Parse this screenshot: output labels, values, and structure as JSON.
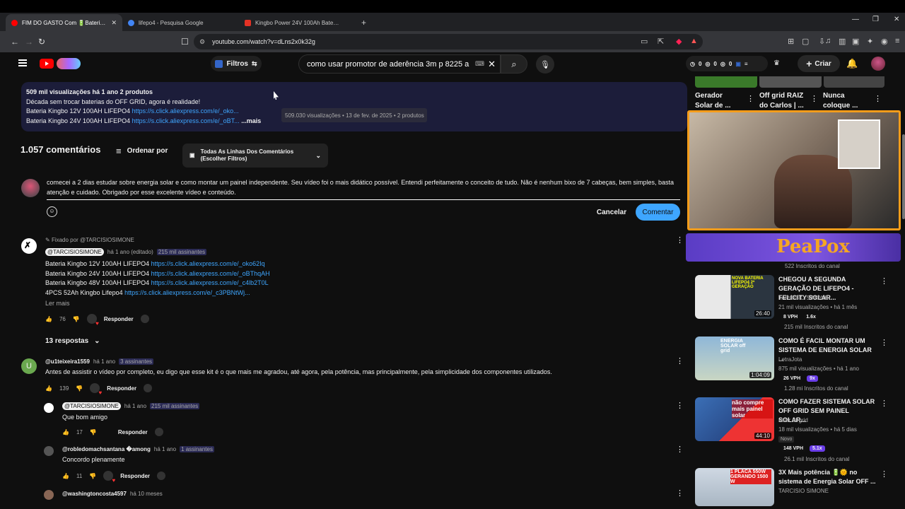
{
  "browser": {
    "tabs": [
      {
        "label": "FIM DO GASTO Com 🔋Baterias d",
        "active": true,
        "color": "#ff0000"
      },
      {
        "label": "lifepo4 - Pesquisa Google",
        "active": false,
        "color": "#4285f4"
      },
      {
        "label": "Kingbo Power 24V 100Ah Bateria Li",
        "active": false,
        "color": "#e43225"
      }
    ],
    "new_tab": "+",
    "url": "youtube.com/watch?v=dLns2x0k32g"
  },
  "youtube": {
    "filtros_label": "Filtros",
    "search_query": "como usar promotor de aderência 3m p 8225 a",
    "counters": [
      "0",
      "0",
      "0"
    ],
    "criar_label": "Criar"
  },
  "description": {
    "stats": "509 mil visualizações  há 1 ano  2 produtos",
    "line1": "Década sem trocar baterias do OFF GRID, agora é realidade!",
    "line2_text": "Bateria Kingbo 12V 100AH LIFEPO4",
    "line2_link": "https://s.click.aliexpress.com/e/_oko...",
    "line3_text": "Bateria Kingbo 24V 100AH LIFEPO4",
    "line3_link": "https://s.click.aliexpress.com/e/_oBT...",
    "more": "...mais",
    "tooltip": "509.030 visualizações • 13 de fev. de 2025 • 2 produtos"
  },
  "comments_header": {
    "count": "1.057 comentários",
    "sort_label": "Ordenar por",
    "filter_label_1": "Todas As Linhas Dos Comentários",
    "filter_label_2": "(Escolher Filtros)"
  },
  "new_comment": {
    "text": "comecei a 2 dias estudar sobre energia solar e como montar um painel independente. Seu vídeo foi o mais didático possível. Entendi perfeitamente o conceito de tudo. Não é nenhum bixo de 7 cabeças, bem simples, basta atenção e cuidado. Obrigado por esse excelente vídeo e conteúdo.",
    "cancel": "Cancelar",
    "submit": "Comentar"
  },
  "comments": [
    {
      "pinned": "Fixado por @TARCISIOSIMONE",
      "author": "@TARCISIOSIMONE",
      "time": "há 1 ano (editado)",
      "subs": "215 mil assinantes",
      "lines": [
        {
          "text": "Bateria Kingbo 12V 100AH LIFEPO4 ",
          "link": "https://s.click.aliexpress.com/e/_oko62Iq"
        },
        {
          "text": "Bateria Kingbo 24V 100AH LIFEPO4 ",
          "link": "https://s.click.aliexpress.com/e/_oBThqAH"
        },
        {
          "text": "Bateria Kingbo 48V 100AH LIFEPO4 ",
          "link": "https://s.click.aliexpress.com/e/_c4lb2T0L"
        },
        {
          "text": "4PCS 52Ah  Kingbo Lifepo4 ",
          "link": "https://s.click.aliexpress.com/e/_c3PBNtWj..."
        }
      ],
      "read_more": "Ler mais",
      "likes": "76",
      "reply": "Responder",
      "replies": "13 respostas"
    },
    {
      "author": "@u1teixeira1559",
      "time": "há 1 ano",
      "subs": "3 assinantes",
      "text": "Antes de assistir o vídeo por completo, eu digo que esse kit é o que mais me agradou, até agora, pela potência, mas principalmente, pela simplicidade dos componentes utilizados.",
      "likes": "139",
      "reply": "Responder",
      "avatar_letter": "U"
    },
    {
      "author": "@TARCISIOSIMONE",
      "time": "há 1 ano",
      "subs": "215 mil assinantes",
      "text": "Que bom amigo",
      "likes": "17",
      "reply": "Responder"
    },
    {
      "author": "@robledomachsantana �among",
      "time": "há 1 ano",
      "subs": "1 assinantes",
      "text": "Concordo plenamente",
      "likes": "11",
      "reply": "Responder"
    },
    {
      "author": "@washingtoncosta4597",
      "time": "há 10 meses"
    }
  ],
  "sidebar": {
    "top_cards": [
      "Gerador Solar de ...",
      "Off grid RAIZ do Carlos | ...",
      "Nunca coloque ..."
    ],
    "banner_text": "PeaPox",
    "banner_subs": "522 Inscritos do canal",
    "videos": [
      {
        "title": "CHEGOU A SEGUNDA GERAÇÃO DE LIFEPO4 - FELICITY SOLAR...",
        "channel": "TARCISIO SIMONE",
        "stats": "21 mil visualizações • há 1 mês",
        "duration": "26:40",
        "vph": "8 VPH",
        "mult": "1.6x",
        "subs": "215 mil Inscritos do canal",
        "thumb_text": "NOVA BATERIA LIFEPO4 2ª GERAÇÃO"
      },
      {
        "title": "COMO É FACIL MONTAR UM SISTEMA DE ENERGIA SOLAR ...",
        "channel": "LetraJota",
        "stats": "875 mil visualizações • há 1 ano",
        "duration": "1:04:09",
        "vph": "26 VPH",
        "mult": "9x",
        "subs": "1.28 mi Inscritos do canal",
        "thumb_text": "ENERGIA SOLAR off grid"
      },
      {
        "title": "COMO FAZER SISTEMA SOLAR OFF GRID SEM PAINEL SOLAR...",
        "channel": "solar of grid",
        "stats": "18 mil visualizações • há 5 dias",
        "duration": "44:10",
        "novo": "Novo",
        "vph": "148 VPH",
        "mult": "5.1x",
        "subs": "26.1 mil Inscritos do canal",
        "thumb_text": "não compre mais painel solar"
      },
      {
        "title": "3X Mais potência 🔋🌞 no sistema de Energia Solar OFF ...",
        "channel": "TARCISIO SIMONE",
        "thumb_text": "1 PLACA 550W GERANDO 1500 W"
      }
    ]
  }
}
